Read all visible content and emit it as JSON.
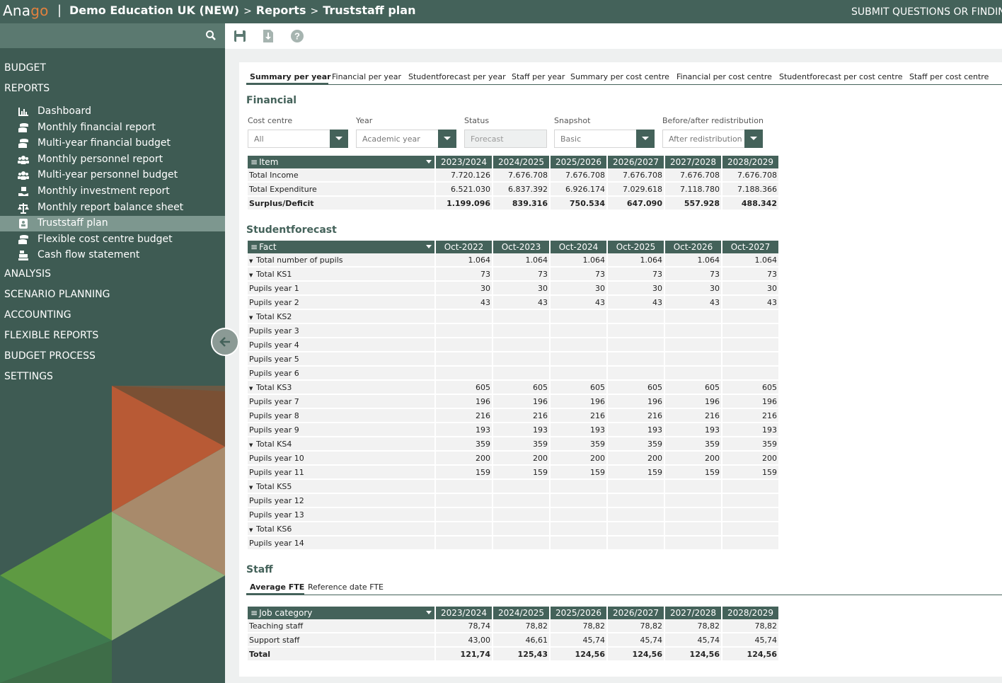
{
  "header": {
    "logo_a": "Ana",
    "logo_b": "go",
    "separator": "|",
    "crumbs": [
      "Demo Education UK (NEW)",
      "Reports",
      "Truststaff plan"
    ],
    "crumb_sep": ">",
    "submit": "SUBMIT QUESTIONS OR FINDINGS"
  },
  "sidebar": {
    "search_icon": "search-icon",
    "top_items": [
      "BUDGET",
      "REPORTS",
      "ANALYSIS",
      "SCENARIO PLANNING",
      "ACCOUNTING",
      "FLEXIBLE REPORTS",
      "BUDGET PROCESS",
      "SETTINGS"
    ],
    "report_items": [
      {
        "label": "Dashboard",
        "icon": "bar-chart-icon"
      },
      {
        "label": "Monthly financial report",
        "icon": "coins-icon"
      },
      {
        "label": "Multi-year financial budget",
        "icon": "coins-icon"
      },
      {
        "label": "Monthly personnel report",
        "icon": "users-icon"
      },
      {
        "label": "Multi-year personnel budget",
        "icon": "users-icon"
      },
      {
        "label": "Monthly investment report",
        "icon": "hand-icon"
      },
      {
        "label": "Monthly report balance sheet",
        "icon": "scale-icon"
      },
      {
        "label": "Truststaff plan",
        "icon": "badge-icon",
        "active": true
      },
      {
        "label": "Flexible cost centre budget",
        "icon": "coins-icon"
      },
      {
        "label": "Cash flow statement",
        "icon": "cash-register-icon"
      }
    ],
    "accent_colors": {
      "orange": "#b85a35",
      "brown": "#7a5034",
      "tan": "#a88a6b",
      "green": "#5e9a42",
      "light_green": "#8fb07a",
      "dark_green": "#3f7a4f"
    }
  },
  "toolbar": {
    "icons": [
      "save-icon",
      "download-icon",
      "help-icon"
    ]
  },
  "tabs": [
    "Summary per year",
    "Financial per year",
    "Studentforecast per year",
    "Staff per year",
    "Summary per cost centre",
    "Financial per cost centre",
    "Studentforecast per cost centre",
    "Staff per cost centre"
  ],
  "financial": {
    "title": "Financial",
    "filters": [
      {
        "label": "Cost centre",
        "value": "All"
      },
      {
        "label": "Year",
        "value": "Academic year"
      },
      {
        "label": "Status",
        "value": "Forecast"
      },
      {
        "label": "Snapshot",
        "value": "Basic"
      },
      {
        "label": "Before/after redistribution",
        "value": "After redistribution"
      }
    ],
    "header": [
      "Item",
      "2023/2024",
      "2024/2025",
      "2025/2026",
      "2026/2027",
      "2027/2028",
      "2028/2029"
    ],
    "rows": [
      {
        "label": "Total Income",
        "values": [
          "7.720.126",
          "7.676.708",
          "7.676.708",
          "7.676.708",
          "7.676.708",
          "7.676.708"
        ]
      },
      {
        "label": "Total Expenditure",
        "values": [
          "6.521.030",
          "6.837.392",
          "6.926.174",
          "7.029.618",
          "7.118.780",
          "7.188.366"
        ]
      },
      {
        "label": "Surplus/Deficit",
        "values": [
          "1.199.096",
          "839.316",
          "750.534",
          "647.090",
          "557.928",
          "488.342"
        ],
        "bold": true
      }
    ]
  },
  "studentforecast": {
    "title": "Studentforecast",
    "header": [
      "Fact",
      "Oct-2022",
      "Oct-2023",
      "Oct-2024",
      "Oct-2025",
      "Oct-2026",
      "Oct-2027"
    ],
    "rows": [
      {
        "label": "Total number of pupils",
        "level": 0,
        "expand": true,
        "values": [
          "1.064",
          "1.064",
          "1.064",
          "1.064",
          "1.064",
          "1.064"
        ]
      },
      {
        "label": "Total KS1",
        "level": 1,
        "expand": true,
        "values": [
          "73",
          "73",
          "73",
          "73",
          "73",
          "73"
        ]
      },
      {
        "label": "Pupils year 1",
        "level": 2,
        "values": [
          "30",
          "30",
          "30",
          "30",
          "30",
          "30"
        ]
      },
      {
        "label": "Pupils year 2",
        "level": 2,
        "values": [
          "43",
          "43",
          "43",
          "43",
          "43",
          "43"
        ]
      },
      {
        "label": "Total KS2",
        "level": 1,
        "expand": true,
        "values": [
          "",
          "",
          "",
          "",
          "",
          ""
        ]
      },
      {
        "label": "Pupils year 3",
        "level": 2,
        "values": [
          "",
          "",
          "",
          "",
          "",
          ""
        ]
      },
      {
        "label": "Pupils year 4",
        "level": 2,
        "values": [
          "",
          "",
          "",
          "",
          "",
          ""
        ]
      },
      {
        "label": "Pupils year 5",
        "level": 2,
        "values": [
          "",
          "",
          "",
          "",
          "",
          ""
        ]
      },
      {
        "label": "Pupils year 6",
        "level": 2,
        "values": [
          "",
          "",
          "",
          "",
          "",
          ""
        ]
      },
      {
        "label": "Total KS3",
        "level": 1,
        "expand": true,
        "values": [
          "605",
          "605",
          "605",
          "605",
          "605",
          "605"
        ]
      },
      {
        "label": "Pupils year 7",
        "level": 2,
        "values": [
          "196",
          "196",
          "196",
          "196",
          "196",
          "196"
        ]
      },
      {
        "label": "Pupils year 8",
        "level": 2,
        "values": [
          "216",
          "216",
          "216",
          "216",
          "216",
          "216"
        ]
      },
      {
        "label": "Pupils year 9",
        "level": 2,
        "values": [
          "193",
          "193",
          "193",
          "193",
          "193",
          "193"
        ]
      },
      {
        "label": "Total KS4",
        "level": 1,
        "expand": true,
        "values": [
          "359",
          "359",
          "359",
          "359",
          "359",
          "359"
        ]
      },
      {
        "label": "Pupils year 10",
        "level": 2,
        "values": [
          "200",
          "200",
          "200",
          "200",
          "200",
          "200"
        ]
      },
      {
        "label": "Pupils year 11",
        "level": 2,
        "values": [
          "159",
          "159",
          "159",
          "159",
          "159",
          "159"
        ]
      },
      {
        "label": "Total KS5",
        "level": 1,
        "expand": true,
        "values": [
          "",
          "",
          "",
          "",
          "",
          ""
        ]
      },
      {
        "label": "Pupils year 12",
        "level": 2,
        "values": [
          "",
          "",
          "",
          "",
          "",
          ""
        ]
      },
      {
        "label": "Pupils year 13",
        "level": 2,
        "values": [
          "",
          "",
          "",
          "",
          "",
          ""
        ]
      },
      {
        "label": "Total KS6",
        "level": 1,
        "expand": true,
        "values": [
          "",
          "",
          "",
          "",
          "",
          ""
        ]
      },
      {
        "label": "Pupils year 14",
        "level": 2,
        "values": [
          "",
          "",
          "",
          "",
          "",
          ""
        ]
      }
    ]
  },
  "staff": {
    "title": "Staff",
    "subtabs": [
      "Average FTE",
      "Reference date FTE"
    ],
    "header": [
      "Job category",
      "2023/2024",
      "2024/2025",
      "2025/2026",
      "2026/2027",
      "2027/2028",
      "2028/2029"
    ],
    "rows": [
      {
        "label": "Teaching staff",
        "values": [
          "78,74",
          "78,82",
          "78,82",
          "78,82",
          "78,82",
          "78,82"
        ]
      },
      {
        "label": "Support staff",
        "values": [
          "43,00",
          "46,61",
          "45,74",
          "45,74",
          "45,74",
          "45,74"
        ]
      },
      {
        "label": "Total",
        "values": [
          "121,74",
          "125,43",
          "124,56",
          "124,56",
          "124,56",
          "124,56"
        ],
        "bold": true
      }
    ]
  }
}
